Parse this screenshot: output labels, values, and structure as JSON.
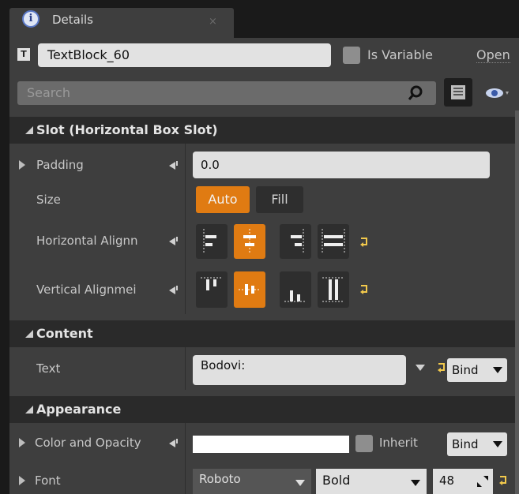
{
  "tab": {
    "label": "Details",
    "close": "×"
  },
  "name_row": {
    "name_value": "TextBlock_60",
    "is_variable_label": "Is Variable",
    "open_label": "Open"
  },
  "search": {
    "placeholder": "Search"
  },
  "sections": {
    "slot": {
      "title": "Slot (Horizontal Box Slot)"
    },
    "content": {
      "title": "Content"
    },
    "appearance": {
      "title": "Appearance"
    }
  },
  "slot": {
    "padding_label": "Padding",
    "padding_value": "0.0",
    "size_label": "Size",
    "size_auto": "Auto",
    "size_fill": "Fill",
    "halign_label": "Horizontal Alignn",
    "valign_label": "Vertical Alignmei"
  },
  "content": {
    "text_label": "Text",
    "text_value": "Bodovi:",
    "bind_label": "Bind"
  },
  "appearance": {
    "color_label": "Color and Opacity",
    "inherit_label": "Inherit",
    "bind_label": "Bind",
    "font_label": "Font",
    "font_family": "Roboto",
    "font_style": "Bold",
    "font_size": "48"
  },
  "colors": {
    "accent": "#e07b12",
    "panel": "#3e3e3e",
    "header": "#2a2a2a",
    "reset_arrow": "#f2c94c"
  },
  "icons": [
    "info-icon",
    "close-icon",
    "text-block-icon",
    "search-icon",
    "view-options-icon",
    "eye-icon",
    "reset-icon",
    "yellow-reset-arrow-icon",
    "dropdown-arrow-icon",
    "expand-arrow-icon"
  ]
}
